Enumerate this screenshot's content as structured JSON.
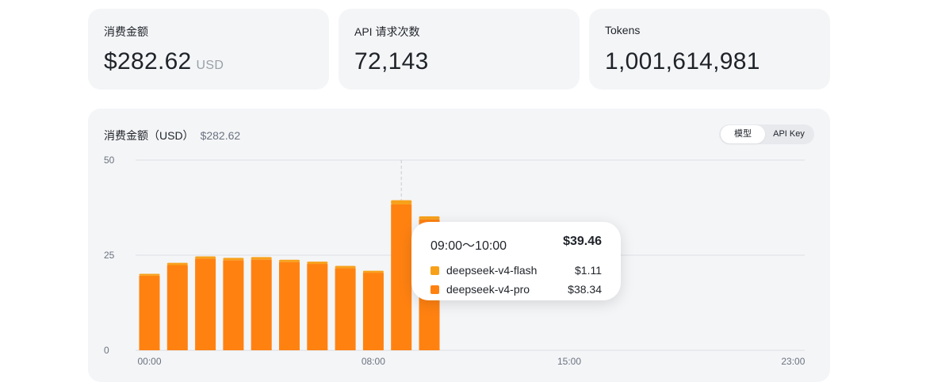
{
  "stats": [
    {
      "label": "消费金额",
      "value": "$282.62",
      "unit": "USD"
    },
    {
      "label": "API 请求次数",
      "value": "72,143",
      "unit": ""
    },
    {
      "label": "Tokens",
      "value": "1,001,614,981",
      "unit": ""
    }
  ],
  "chart": {
    "title": "消费金额（USD）",
    "total": "$282.62",
    "toggle": {
      "active": "模型",
      "inactive": "API Key"
    }
  },
  "tooltip": {
    "range": "09:00～10:00",
    "total": "$39.46",
    "rows": [
      {
        "name": "deepseek-v4-flash",
        "value": "$1.11",
        "color": "#f7a11a"
      },
      {
        "name": "deepseek-v4-pro",
        "value": "$38.34",
        "color": "#ff8211"
      }
    ]
  },
  "colors": {
    "flash": "#f7a11a",
    "pro": "#ff8211",
    "grid": "#dcdfe4",
    "card": "#f4f5f7"
  },
  "chart_data": {
    "type": "bar",
    "stacked": true,
    "categories": [
      "00:00",
      "01:00",
      "02:00",
      "03:00",
      "04:00",
      "05:00",
      "06:00",
      "07:00",
      "08:00",
      "09:00",
      "10:00",
      "11:00",
      "12:00",
      "13:00",
      "14:00",
      "15:00",
      "16:00",
      "17:00",
      "18:00",
      "19:00",
      "20:00",
      "21:00",
      "22:00",
      "23:00"
    ],
    "x_tick_labels": [
      "00:00",
      "08:00",
      "15:00",
      "23:00"
    ],
    "series": [
      {
        "name": "deepseek-v4-flash",
        "values": [
          0.5,
          0.6,
          0.6,
          0.6,
          0.6,
          0.6,
          0.6,
          0.6,
          0.5,
          1.11,
          0.8,
          null,
          null,
          null,
          null,
          null,
          null,
          null,
          null,
          null,
          null,
          null,
          null,
          null
        ]
      },
      {
        "name": "deepseek-v4-pro",
        "values": [
          19.6,
          22.4,
          24.1,
          23.7,
          23.9,
          23.2,
          22.7,
          21.6,
          20.4,
          38.34,
          34.4,
          null,
          null,
          null,
          null,
          null,
          null,
          null,
          null,
          null,
          null,
          null,
          null,
          null
        ]
      }
    ],
    "ylim": [
      0,
      50
    ],
    "yticks": [
      0,
      25,
      50
    ],
    "grid": true,
    "highlight_index": 9
  }
}
